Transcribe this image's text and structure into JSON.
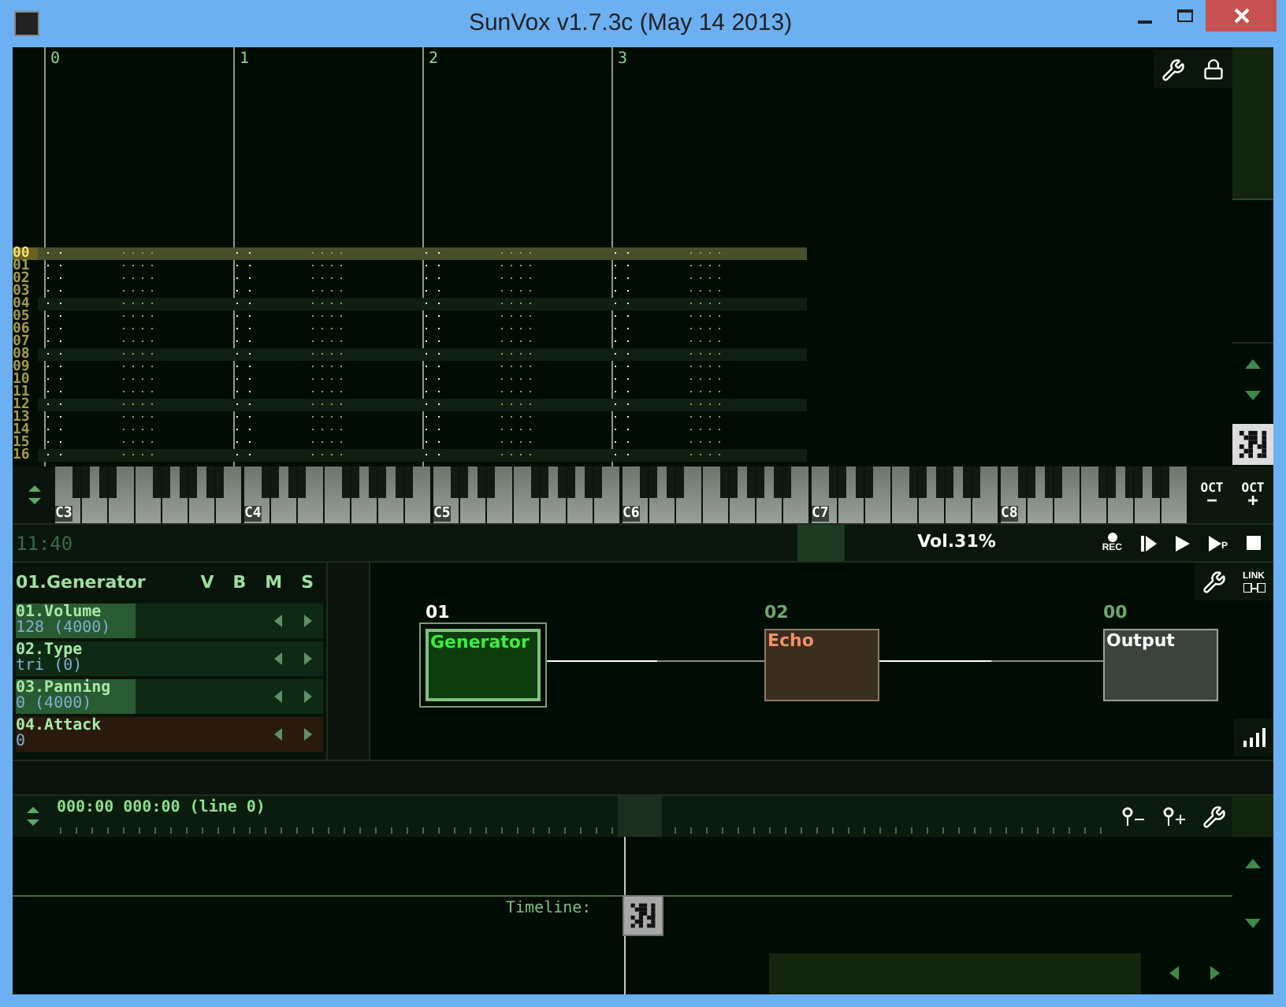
{
  "window": {
    "title": "SunVox v1.7.3c (May 14 2013)"
  },
  "pattern": {
    "tracks": [
      "0",
      "1",
      "2",
      "3"
    ],
    "rows": [
      {
        "label": "00",
        "selected": true
      },
      {
        "label": "01",
        "selected": false
      },
      {
        "label": "02",
        "selected": false
      },
      {
        "label": "03",
        "selected": false
      },
      {
        "label": "04",
        "selected": false
      },
      {
        "label": "05",
        "selected": false
      },
      {
        "label": "06",
        "selected": false
      },
      {
        "label": "07",
        "selected": false
      },
      {
        "label": "08",
        "selected": false
      },
      {
        "label": "09",
        "selected": false
      },
      {
        "label": "10",
        "selected": false
      },
      {
        "label": "11",
        "selected": false
      },
      {
        "label": "12",
        "selected": false
      },
      {
        "label": "13",
        "selected": false
      },
      {
        "label": "14",
        "selected": false
      },
      {
        "label": "15",
        "selected": false
      },
      {
        "label": "16",
        "selected": false
      }
    ]
  },
  "keyboard": {
    "octaves": [
      "C3",
      "C4",
      "C5",
      "C6",
      "C7",
      "C8"
    ],
    "octave_buttons": [
      {
        "label": "OCT",
        "sign": "−"
      },
      {
        "label": "OCT",
        "sign": "+"
      }
    ]
  },
  "status_bar": {
    "time": "11:40",
    "volume": "Vol.31%",
    "rec_label": "REC",
    "pattern_play_label": "P"
  },
  "module_panel": {
    "title": "01.Generator",
    "flags": [
      "V",
      "B",
      "M",
      "S"
    ],
    "controllers": [
      {
        "name": "01.Volume",
        "value": "128 (4000)",
        "level": 0.39,
        "color": "#0f2a14"
      },
      {
        "name": "02.Type",
        "value": "tri (0)",
        "level": 0,
        "color": "#0f2a14"
      },
      {
        "name": "03.Panning",
        "value": "0 (4000)",
        "level": 0.39,
        "color": "#0f2a14"
      },
      {
        "name": "04.Attack",
        "value": "0",
        "level": 0,
        "color": "#2a1a0e"
      }
    ]
  },
  "modules": {
    "link_label": "LINK",
    "items": [
      {
        "number": "01",
        "name": "Generator",
        "kind": "generator",
        "selected": true
      },
      {
        "number": "02",
        "name": "Echo",
        "kind": "effect",
        "selected": false
      },
      {
        "number": "00",
        "name": "Output",
        "kind": "output",
        "selected": false
      }
    ]
  },
  "timeline": {
    "position": "000:00 000:00 (line 0)",
    "label": "Timeline:"
  }
}
